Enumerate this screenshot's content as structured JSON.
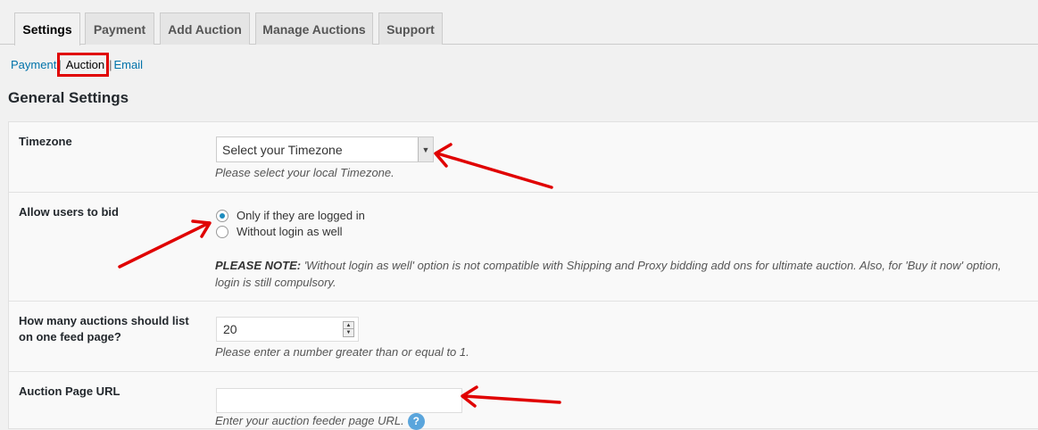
{
  "tabs": [
    {
      "label": "Settings",
      "active": true
    },
    {
      "label": "Payment",
      "active": false
    },
    {
      "label": "Add Auction",
      "active": false
    },
    {
      "label": "Manage Auctions",
      "active": false
    },
    {
      "label": "Support",
      "active": false
    }
  ],
  "subnav": {
    "items": [
      "Payment",
      "Auction",
      "Email"
    ],
    "separator": "|",
    "current": "Auction"
  },
  "page_title": "General Settings",
  "timezone": {
    "label": "Timezone",
    "selected": "Select your Timezone",
    "description": "Please select your local Timezone."
  },
  "allow_bid": {
    "label": "Allow users to bid",
    "options": [
      {
        "label": "Only if they are logged in",
        "checked": true
      },
      {
        "label": "Without login as well",
        "checked": false
      }
    ],
    "note_prefix": "PLEASE NOTE:",
    "note_text": " 'Without login as well' option is not compatible with Shipping and Proxy bidding add ons for ultimate auction. Also, for 'Buy it now' option, login is still compulsory."
  },
  "feed": {
    "label": "How many auctions should list on one feed page?",
    "value": "20",
    "description": "Please enter a number greater than or equal to 1."
  },
  "page_url": {
    "label": "Auction Page URL",
    "value": "",
    "description": "Enter your auction feeder page URL.",
    "help_icon_text": "?"
  },
  "colors": {
    "annotation_red": "#e00000",
    "link_blue": "#0073aa",
    "radio_blue": "#1e8cbe"
  }
}
